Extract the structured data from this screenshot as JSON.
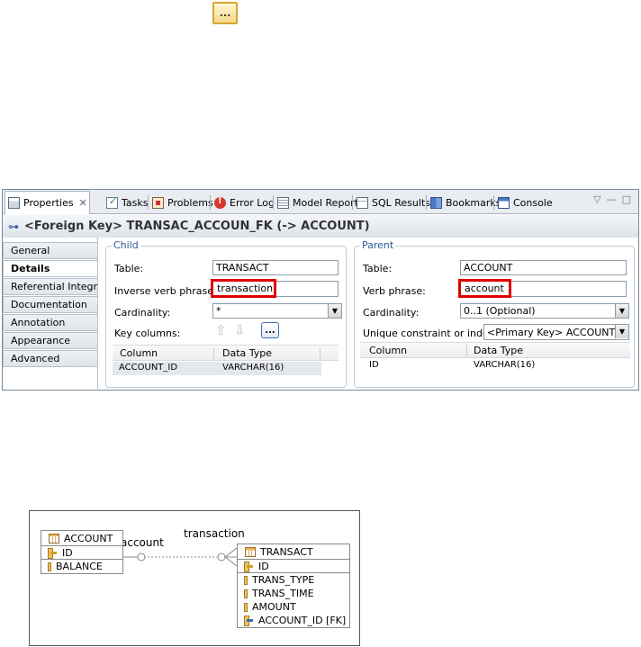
{
  "top_button": {
    "label": "..."
  },
  "tabs": [
    {
      "label": "Properties",
      "icon": "properties-icon",
      "closable": true
    },
    {
      "label": "Tasks",
      "icon": "tasks-icon"
    },
    {
      "label": "Problems",
      "icon": "problems-icon"
    },
    {
      "label": "Error Log",
      "icon": "error-log-icon"
    },
    {
      "label": "Model Report",
      "icon": "model-report-icon"
    },
    {
      "label": "SQL Results",
      "icon": "sql-results-icon"
    },
    {
      "label": "Bookmarks",
      "icon": "bookmarks-icon"
    },
    {
      "label": "Console",
      "icon": "console-icon"
    }
  ],
  "view_controls": {
    "menu": "▽",
    "minimize": "—",
    "maximize": "□"
  },
  "title": "<Foreign Key> TRANSAC_ACCOUN_FK (-> ACCOUNT)",
  "side_tabs": [
    "General",
    "Details",
    "Referential Integrity",
    "Documentation",
    "Annotation",
    "Appearance",
    "Advanced"
  ],
  "active_side_tab": "Details",
  "child": {
    "group_label": "Child",
    "table_label": "Table:",
    "table_value": "TRANSACT",
    "inverse_label": "Inverse verb phrase:",
    "inverse_value": "transaction",
    "cardinality_label": "Cardinality:",
    "cardinality_value": "*",
    "key_columns_label": "Key columns:",
    "key_columns_button": "...",
    "columns_header": [
      "Column",
      "Data Type"
    ],
    "rows": [
      {
        "column": "ACCOUNT_ID",
        "type": "VARCHAR(16)"
      }
    ]
  },
  "parent": {
    "group_label": "Parent",
    "table_label": "Table:",
    "table_value": "ACCOUNT",
    "verb_label": "Verb phrase:",
    "verb_value": "account",
    "cardinality_label": "Cardinality:",
    "cardinality_value": "0..1 (Optional)",
    "unique_label": "Unique constraint or index:",
    "unique_value": "<Primary Key> ACCOUNT_PK",
    "columns_header": [
      "Column",
      "Data Type"
    ],
    "rows": [
      {
        "column": "ID",
        "type": "VARCHAR(16)"
      }
    ]
  },
  "diagram": {
    "account": {
      "name": "ACCOUNT",
      "pk": "ID",
      "columns": [
        "BALANCE"
      ]
    },
    "transact": {
      "name": "TRANSACT",
      "pk": "ID",
      "columns": [
        "TRANS_TYPE",
        "TRANS_TIME",
        "AMOUNT",
        "ACCOUNT_ID [FK]"
      ]
    },
    "label_account": "account",
    "label_transaction": "transaction"
  }
}
